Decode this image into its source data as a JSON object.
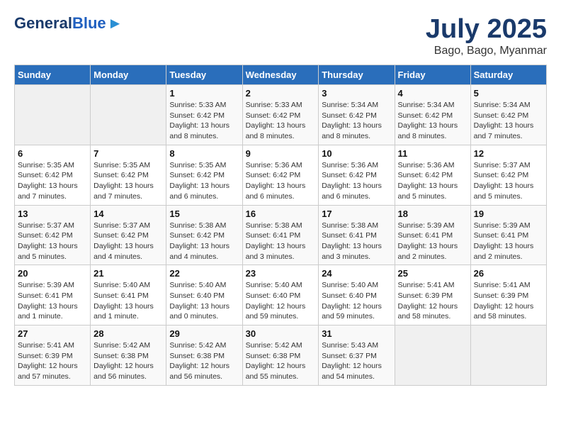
{
  "header": {
    "logo_general": "General",
    "logo_blue": "Blue",
    "month_title": "July 2025",
    "location": "Bago, Bago, Myanmar"
  },
  "days_of_week": [
    "Sunday",
    "Monday",
    "Tuesday",
    "Wednesday",
    "Thursday",
    "Friday",
    "Saturday"
  ],
  "weeks": [
    [
      {
        "num": "",
        "info": ""
      },
      {
        "num": "",
        "info": ""
      },
      {
        "num": "1",
        "info": "Sunrise: 5:33 AM\nSunset: 6:42 PM\nDaylight: 13 hours and 8 minutes."
      },
      {
        "num": "2",
        "info": "Sunrise: 5:33 AM\nSunset: 6:42 PM\nDaylight: 13 hours and 8 minutes."
      },
      {
        "num": "3",
        "info": "Sunrise: 5:34 AM\nSunset: 6:42 PM\nDaylight: 13 hours and 8 minutes."
      },
      {
        "num": "4",
        "info": "Sunrise: 5:34 AM\nSunset: 6:42 PM\nDaylight: 13 hours and 8 minutes."
      },
      {
        "num": "5",
        "info": "Sunrise: 5:34 AM\nSunset: 6:42 PM\nDaylight: 13 hours and 7 minutes."
      }
    ],
    [
      {
        "num": "6",
        "info": "Sunrise: 5:35 AM\nSunset: 6:42 PM\nDaylight: 13 hours and 7 minutes."
      },
      {
        "num": "7",
        "info": "Sunrise: 5:35 AM\nSunset: 6:42 PM\nDaylight: 13 hours and 7 minutes."
      },
      {
        "num": "8",
        "info": "Sunrise: 5:35 AM\nSunset: 6:42 PM\nDaylight: 13 hours and 6 minutes."
      },
      {
        "num": "9",
        "info": "Sunrise: 5:36 AM\nSunset: 6:42 PM\nDaylight: 13 hours and 6 minutes."
      },
      {
        "num": "10",
        "info": "Sunrise: 5:36 AM\nSunset: 6:42 PM\nDaylight: 13 hours and 6 minutes."
      },
      {
        "num": "11",
        "info": "Sunrise: 5:36 AM\nSunset: 6:42 PM\nDaylight: 13 hours and 5 minutes."
      },
      {
        "num": "12",
        "info": "Sunrise: 5:37 AM\nSunset: 6:42 PM\nDaylight: 13 hours and 5 minutes."
      }
    ],
    [
      {
        "num": "13",
        "info": "Sunrise: 5:37 AM\nSunset: 6:42 PM\nDaylight: 13 hours and 5 minutes."
      },
      {
        "num": "14",
        "info": "Sunrise: 5:37 AM\nSunset: 6:42 PM\nDaylight: 13 hours and 4 minutes."
      },
      {
        "num": "15",
        "info": "Sunrise: 5:38 AM\nSunset: 6:42 PM\nDaylight: 13 hours and 4 minutes."
      },
      {
        "num": "16",
        "info": "Sunrise: 5:38 AM\nSunset: 6:41 PM\nDaylight: 13 hours and 3 minutes."
      },
      {
        "num": "17",
        "info": "Sunrise: 5:38 AM\nSunset: 6:41 PM\nDaylight: 13 hours and 3 minutes."
      },
      {
        "num": "18",
        "info": "Sunrise: 5:39 AM\nSunset: 6:41 PM\nDaylight: 13 hours and 2 minutes."
      },
      {
        "num": "19",
        "info": "Sunrise: 5:39 AM\nSunset: 6:41 PM\nDaylight: 13 hours and 2 minutes."
      }
    ],
    [
      {
        "num": "20",
        "info": "Sunrise: 5:39 AM\nSunset: 6:41 PM\nDaylight: 13 hours and 1 minute."
      },
      {
        "num": "21",
        "info": "Sunrise: 5:40 AM\nSunset: 6:41 PM\nDaylight: 13 hours and 1 minute."
      },
      {
        "num": "22",
        "info": "Sunrise: 5:40 AM\nSunset: 6:40 PM\nDaylight: 13 hours and 0 minutes."
      },
      {
        "num": "23",
        "info": "Sunrise: 5:40 AM\nSunset: 6:40 PM\nDaylight: 12 hours and 59 minutes."
      },
      {
        "num": "24",
        "info": "Sunrise: 5:40 AM\nSunset: 6:40 PM\nDaylight: 12 hours and 59 minutes."
      },
      {
        "num": "25",
        "info": "Sunrise: 5:41 AM\nSunset: 6:39 PM\nDaylight: 12 hours and 58 minutes."
      },
      {
        "num": "26",
        "info": "Sunrise: 5:41 AM\nSunset: 6:39 PM\nDaylight: 12 hours and 58 minutes."
      }
    ],
    [
      {
        "num": "27",
        "info": "Sunrise: 5:41 AM\nSunset: 6:39 PM\nDaylight: 12 hours and 57 minutes."
      },
      {
        "num": "28",
        "info": "Sunrise: 5:42 AM\nSunset: 6:38 PM\nDaylight: 12 hours and 56 minutes."
      },
      {
        "num": "29",
        "info": "Sunrise: 5:42 AM\nSunset: 6:38 PM\nDaylight: 12 hours and 56 minutes."
      },
      {
        "num": "30",
        "info": "Sunrise: 5:42 AM\nSunset: 6:38 PM\nDaylight: 12 hours and 55 minutes."
      },
      {
        "num": "31",
        "info": "Sunrise: 5:43 AM\nSunset: 6:37 PM\nDaylight: 12 hours and 54 minutes."
      },
      {
        "num": "",
        "info": ""
      },
      {
        "num": "",
        "info": ""
      }
    ]
  ]
}
